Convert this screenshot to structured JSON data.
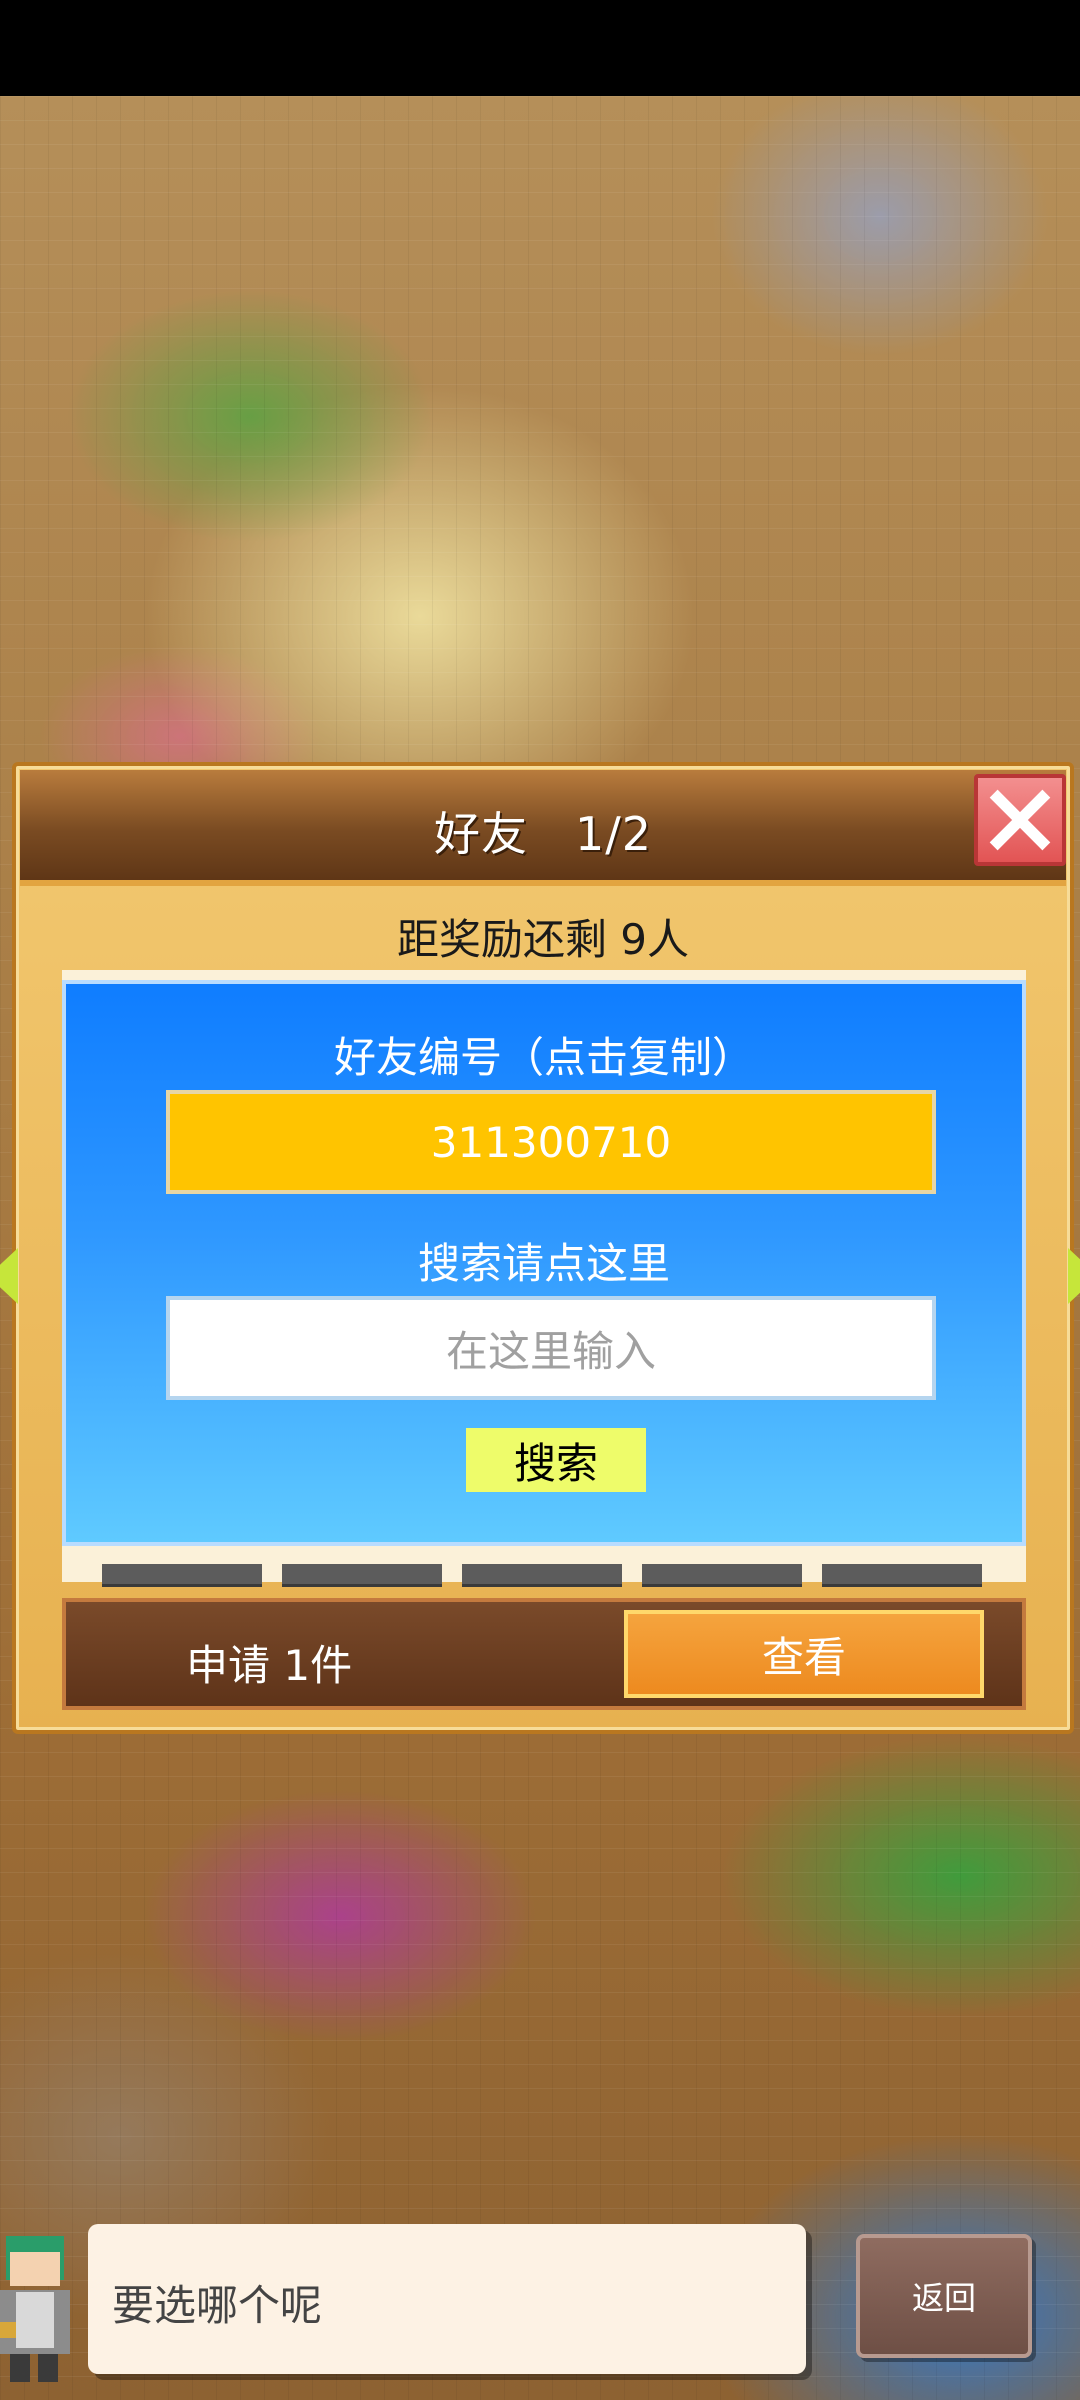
{
  "dialog": {
    "title": "好友　1/2",
    "reward_text": "距奖励还剩 9人",
    "friend_id_label": "好友编号（点击复制）",
    "friend_id": "311300710",
    "search_label": "搜索请点这里",
    "search_placeholder": "在这里输入",
    "search_button": "搜索",
    "request_text": "申请 1件",
    "view_button": "查看"
  },
  "bottom": {
    "speech_text": "要选哪个呢",
    "back_button": "返回"
  },
  "icons": {
    "close": "close-icon",
    "arrow_left": "arrow-left-icon",
    "arrow_right": "arrow-right-icon",
    "avatar": "character-avatar"
  },
  "colors": {
    "panel_blue": "#2f98ff",
    "friend_id_yellow": "#ffc400",
    "view_orange": "#ed8a1f",
    "search_button_yellow": "#eefc6a"
  }
}
